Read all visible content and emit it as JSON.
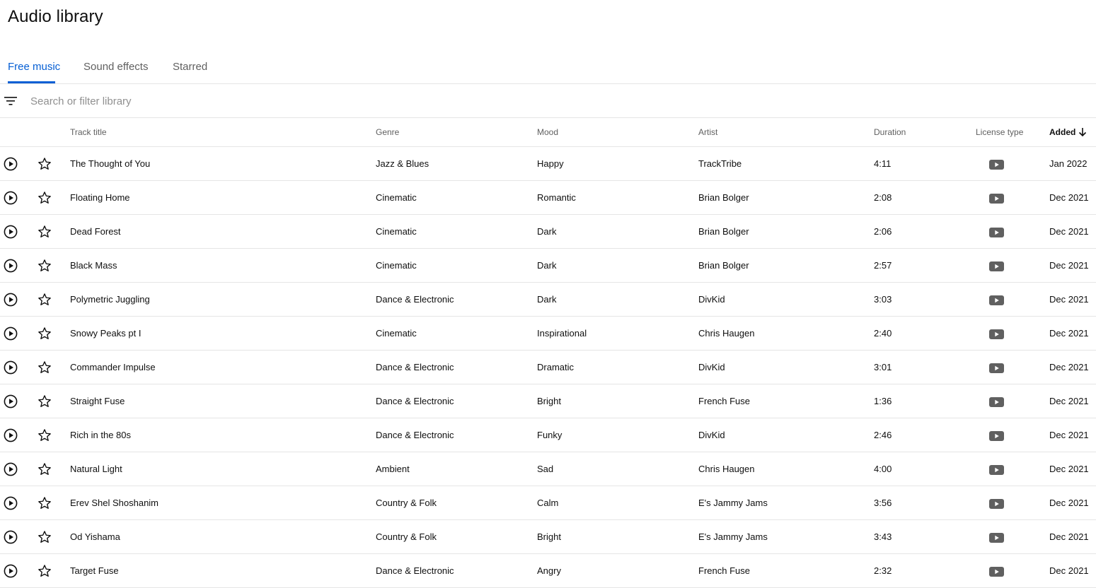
{
  "page": {
    "title": "Audio library"
  },
  "tabs": [
    {
      "label": "Free music",
      "active": true
    },
    {
      "label": "Sound effects",
      "active": false
    },
    {
      "label": "Starred",
      "active": false
    }
  ],
  "search": {
    "placeholder": "Search or filter library",
    "value": ""
  },
  "columns": {
    "track_title": "Track title",
    "genre": "Genre",
    "mood": "Mood",
    "artist": "Artist",
    "duration": "Duration",
    "license_type": "License type",
    "added": "Added"
  },
  "sort": {
    "column": "added",
    "direction": "descending",
    "icon": "arrow-down-icon"
  },
  "colors": {
    "accent": "#065fd4",
    "divider": "#e5e5e5",
    "secondary_text": "#606060",
    "license_icon": "#606060"
  },
  "icons": {
    "filter": "filter-icon",
    "play": "play-circle-icon",
    "star": "star-outline-icon",
    "license": "youtube-icon"
  },
  "tracks": [
    {
      "title": "The Thought of You",
      "genre": "Jazz & Blues",
      "mood": "Happy",
      "artist": "TrackTribe",
      "duration": "4:11",
      "added": "Jan 2022"
    },
    {
      "title": "Floating Home",
      "genre": "Cinematic",
      "mood": "Romantic",
      "artist": "Brian Bolger",
      "duration": "2:08",
      "added": "Dec 2021"
    },
    {
      "title": "Dead Forest",
      "genre": "Cinematic",
      "mood": "Dark",
      "artist": "Brian Bolger",
      "duration": "2:06",
      "added": "Dec 2021"
    },
    {
      "title": "Black Mass",
      "genre": "Cinematic",
      "mood": "Dark",
      "artist": "Brian Bolger",
      "duration": "2:57",
      "added": "Dec 2021"
    },
    {
      "title": "Polymetric Juggling",
      "genre": "Dance & Electronic",
      "mood": "Dark",
      "artist": "DivKid",
      "duration": "3:03",
      "added": "Dec 2021"
    },
    {
      "title": "Snowy Peaks pt I",
      "genre": "Cinematic",
      "mood": "Inspirational",
      "artist": "Chris Haugen",
      "duration": "2:40",
      "added": "Dec 2021"
    },
    {
      "title": "Commander Impulse",
      "genre": "Dance & Electronic",
      "mood": "Dramatic",
      "artist": "DivKid",
      "duration": "3:01",
      "added": "Dec 2021"
    },
    {
      "title": "Straight Fuse",
      "genre": "Dance & Electronic",
      "mood": "Bright",
      "artist": "French Fuse",
      "duration": "1:36",
      "added": "Dec 2021"
    },
    {
      "title": "Rich in the 80s",
      "genre": "Dance & Electronic",
      "mood": "Funky",
      "artist": "DivKid",
      "duration": "2:46",
      "added": "Dec 2021"
    },
    {
      "title": "Natural Light",
      "genre": "Ambient",
      "mood": "Sad",
      "artist": "Chris Haugen",
      "duration": "4:00",
      "added": "Dec 2021"
    },
    {
      "title": "Erev Shel Shoshanim",
      "genre": "Country & Folk",
      "mood": "Calm",
      "artist": "E's Jammy Jams",
      "duration": "3:56",
      "added": "Dec 2021"
    },
    {
      "title": "Od Yishama",
      "genre": "Country & Folk",
      "mood": "Bright",
      "artist": "E's Jammy Jams",
      "duration": "3:43",
      "added": "Dec 2021"
    },
    {
      "title": "Target Fuse",
      "genre": "Dance & Electronic",
      "mood": "Angry",
      "artist": "French Fuse",
      "duration": "2:32",
      "added": "Dec 2021"
    }
  ]
}
